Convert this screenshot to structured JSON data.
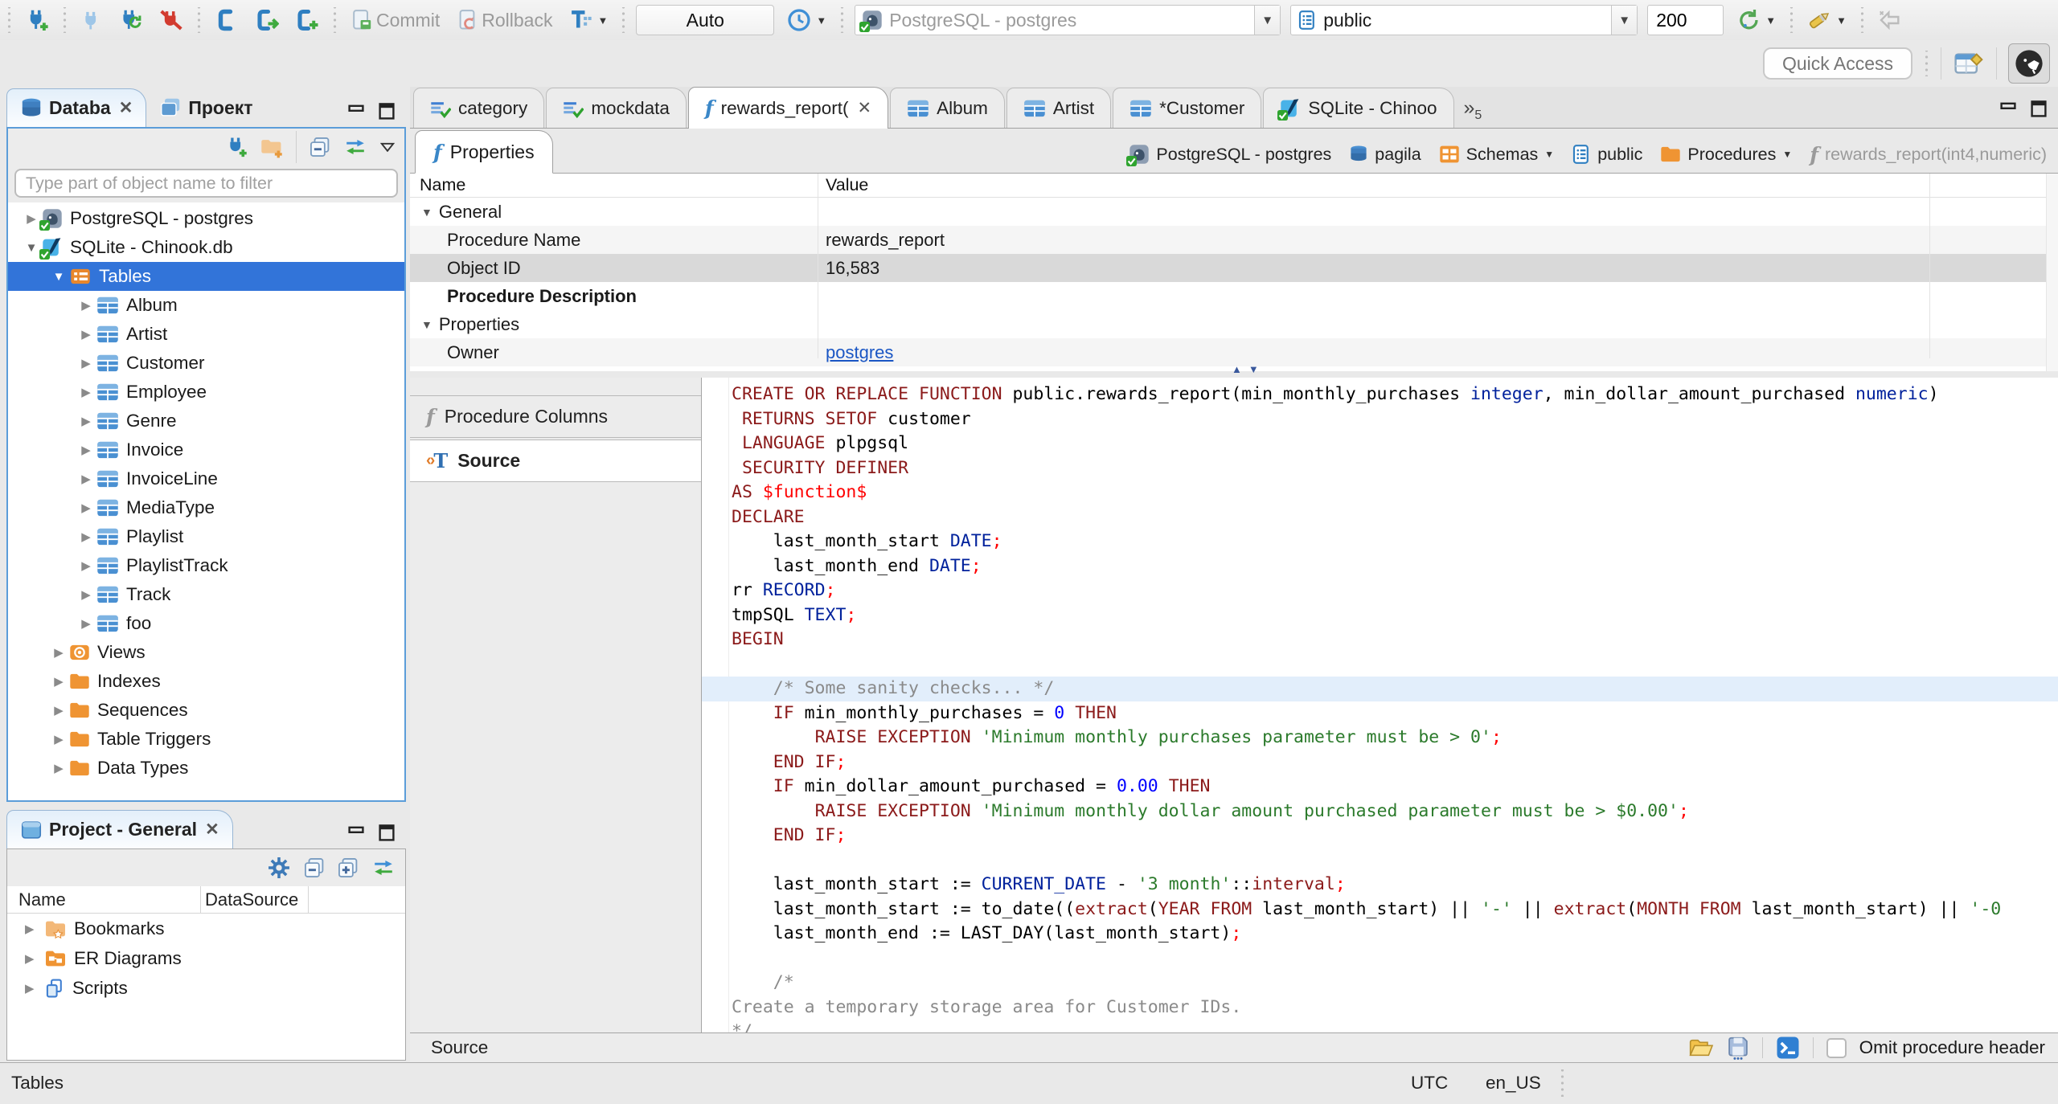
{
  "toolbar": {
    "commit_label": "Commit",
    "rollback_label": "Rollback",
    "auto_label": "Auto",
    "connection_combo_value": "PostgreSQL - postgres",
    "schema_combo_value": "public",
    "fetch_size_value": "200",
    "quick_access_placeholder": "Quick Access"
  },
  "left_panel": {
    "tabs": [
      {
        "label": "Databa",
        "closable": true,
        "active": true
      },
      {
        "label": "Проект",
        "closable": false,
        "active": false
      }
    ],
    "filter_placeholder": "Type part of object name to filter",
    "tree": [
      {
        "label": "PostgreSQL - postgres",
        "type": "postgres",
        "level": 0,
        "state": "collapsed"
      },
      {
        "label": "SQLite - Chinook.db",
        "type": "sqlite",
        "level": 0,
        "state": "expanded"
      },
      {
        "label": "Tables",
        "type": "tables-folder",
        "level": 1,
        "state": "expanded",
        "selected": true
      },
      {
        "label": "Album",
        "type": "table",
        "level": 2,
        "state": "collapsed"
      },
      {
        "label": "Artist",
        "type": "table",
        "level": 2,
        "state": "collapsed"
      },
      {
        "label": "Customer",
        "type": "table",
        "level": 2,
        "state": "collapsed"
      },
      {
        "label": "Employee",
        "type": "table",
        "level": 2,
        "state": "collapsed"
      },
      {
        "label": "Genre",
        "type": "table",
        "level": 2,
        "state": "collapsed"
      },
      {
        "label": "Invoice",
        "type": "table",
        "level": 2,
        "state": "collapsed"
      },
      {
        "label": "InvoiceLine",
        "type": "table",
        "level": 2,
        "state": "collapsed"
      },
      {
        "label": "MediaType",
        "type": "table",
        "level": 2,
        "state": "collapsed"
      },
      {
        "label": "Playlist",
        "type": "table",
        "level": 2,
        "state": "collapsed"
      },
      {
        "label": "PlaylistTrack",
        "type": "table",
        "level": 2,
        "state": "collapsed"
      },
      {
        "label": "Track",
        "type": "table",
        "level": 2,
        "state": "collapsed"
      },
      {
        "label": "foo",
        "type": "table",
        "level": 2,
        "state": "collapsed"
      },
      {
        "label": "Views",
        "type": "views-folder",
        "level": 1,
        "state": "collapsed"
      },
      {
        "label": "Indexes",
        "type": "folder",
        "level": 1,
        "state": "collapsed"
      },
      {
        "label": "Sequences",
        "type": "folder",
        "level": 1,
        "state": "collapsed"
      },
      {
        "label": "Table Triggers",
        "type": "folder",
        "level": 1,
        "state": "collapsed"
      },
      {
        "label": "Data Types",
        "type": "folder",
        "level": 1,
        "state": "collapsed"
      }
    ]
  },
  "project_panel": {
    "title": "Project - General",
    "columns": [
      "Name",
      "DataSource"
    ],
    "items": [
      {
        "label": "Bookmarks",
        "type": "bookmark-folder"
      },
      {
        "label": "ER Diagrams",
        "type": "er-folder"
      },
      {
        "label": "Scripts",
        "type": "scripts"
      }
    ]
  },
  "editor_tabs": [
    {
      "label": "category",
      "icon": "sql-script",
      "active": false,
      "closable": false
    },
    {
      "label": "mockdata",
      "icon": "sql-script",
      "active": false,
      "closable": false
    },
    {
      "label": "rewards_report(",
      "icon": "function",
      "active": true,
      "closable": true
    },
    {
      "label": "Album",
      "icon": "table",
      "active": false,
      "closable": false
    },
    {
      "label": "Artist",
      "icon": "table",
      "active": false,
      "closable": false
    },
    {
      "label": "*Customer",
      "icon": "table",
      "active": false,
      "closable": false
    },
    {
      "label": "SQLite - Chinoo",
      "icon": "sqlite",
      "active": false,
      "closable": false
    }
  ],
  "tab_overflow_count": "5",
  "properties_view": {
    "tab_label": "Properties",
    "breadcrumb": [
      {
        "label": "PostgreSQL - postgres",
        "icon": "postgres",
        "dropdown": false,
        "disabled": false
      },
      {
        "label": "pagila",
        "icon": "database",
        "dropdown": false,
        "disabled": false
      },
      {
        "label": "Schemas",
        "icon": "schemas",
        "dropdown": true,
        "disabled": false
      },
      {
        "label": "public",
        "icon": "schema",
        "dropdown": false,
        "disabled": false
      },
      {
        "label": "Procedures",
        "icon": "folder",
        "dropdown": true,
        "disabled": false
      },
      {
        "label": "rewards_report(int4,numeric)",
        "icon": "function",
        "dropdown": false,
        "disabled": true
      }
    ],
    "grid": {
      "columns": [
        "Name",
        "Value"
      ],
      "rows": [
        {
          "name": "General",
          "value": "",
          "group": true
        },
        {
          "name": "Procedure Name",
          "value": "rewards_report",
          "alt": true
        },
        {
          "name": "Object ID",
          "value": "16,583",
          "selected": true
        },
        {
          "name": "Procedure Description",
          "value": "",
          "bold": true
        },
        {
          "name": "Properties",
          "value": "",
          "group": true
        },
        {
          "name": "Owner",
          "value": "postgres",
          "link": true,
          "alt": true
        }
      ]
    },
    "sub_tabs": [
      {
        "label": "Procedure Columns",
        "active": false
      },
      {
        "label": "Source",
        "active": true
      }
    ]
  },
  "source_editor": {
    "colors": {
      "kw": "#8b1a1a",
      "ty": "#00219c",
      "nm": "#0000ff",
      "st": "#2b7a2b",
      "rd": "#ff0000",
      "cm": "#8a8a8a",
      "pl": "#000000"
    },
    "highlight_color": "#e2eefb",
    "lines": [
      {
        "tokens": [
          [
            "kw",
            "CREATE OR REPLACE FUNCTION"
          ],
          [
            "pl",
            " public.rewards_report(min_monthly_purchases "
          ],
          [
            "ty",
            "integer"
          ],
          [
            "pl",
            ", min_dollar_amount_purchased "
          ],
          [
            "ty",
            "numeric"
          ],
          [
            "pl",
            ")"
          ]
        ]
      },
      {
        "tokens": [
          [
            "pl",
            " "
          ],
          [
            "kw",
            "RETURNS SETOF"
          ],
          [
            "pl",
            " customer"
          ]
        ]
      },
      {
        "tokens": [
          [
            "pl",
            " "
          ],
          [
            "kw",
            "LANGUAGE"
          ],
          [
            "pl",
            " plpgsql"
          ]
        ]
      },
      {
        "tokens": [
          [
            "pl",
            " "
          ],
          [
            "kw",
            "SECURITY DEFINER"
          ]
        ]
      },
      {
        "tokens": [
          [
            "kw",
            "AS"
          ],
          [
            "pl",
            " "
          ],
          [
            "rd",
            "$function$"
          ]
        ]
      },
      {
        "tokens": [
          [
            "kw",
            "DECLARE"
          ]
        ]
      },
      {
        "tokens": [
          [
            "pl",
            "    last_month_start "
          ],
          [
            "ty",
            "DATE"
          ],
          [
            "rd",
            ";"
          ]
        ]
      },
      {
        "tokens": [
          [
            "pl",
            "    last_month_end "
          ],
          [
            "ty",
            "DATE"
          ],
          [
            "rd",
            ";"
          ]
        ]
      },
      {
        "tokens": [
          [
            "pl",
            "rr "
          ],
          [
            "ty",
            "RECORD"
          ],
          [
            "rd",
            ";"
          ]
        ]
      },
      {
        "tokens": [
          [
            "pl",
            "tmpSQL "
          ],
          [
            "ty",
            "TEXT"
          ],
          [
            "rd",
            ";"
          ]
        ]
      },
      {
        "tokens": [
          [
            "kw",
            "BEGIN"
          ]
        ]
      },
      {
        "tokens": []
      },
      {
        "tokens": [
          [
            "cm",
            "    /* Some sanity checks... */"
          ]
        ],
        "highlight": true
      },
      {
        "tokens": [
          [
            "pl",
            "    "
          ],
          [
            "kw",
            "IF"
          ],
          [
            "pl",
            " min_monthly_purchases = "
          ],
          [
            "nm",
            "0"
          ],
          [
            "pl",
            " "
          ],
          [
            "kw",
            "THEN"
          ]
        ]
      },
      {
        "tokens": [
          [
            "pl",
            "        "
          ],
          [
            "kw",
            "RAISE EXCEPTION"
          ],
          [
            "pl",
            " "
          ],
          [
            "st",
            "'Minimum monthly purchases parameter must be > 0'"
          ],
          [
            "rd",
            ";"
          ]
        ]
      },
      {
        "tokens": [
          [
            "pl",
            "    "
          ],
          [
            "kw",
            "END IF"
          ],
          [
            "rd",
            ";"
          ]
        ]
      },
      {
        "tokens": [
          [
            "pl",
            "    "
          ],
          [
            "kw",
            "IF"
          ],
          [
            "pl",
            " min_dollar_amount_purchased = "
          ],
          [
            "nm",
            "0.00"
          ],
          [
            "pl",
            " "
          ],
          [
            "kw",
            "THEN"
          ]
        ]
      },
      {
        "tokens": [
          [
            "pl",
            "        "
          ],
          [
            "kw",
            "RAISE EXCEPTION"
          ],
          [
            "pl",
            " "
          ],
          [
            "st",
            "'Minimum monthly dollar amount purchased parameter must be > $0.00'"
          ],
          [
            "rd",
            ";"
          ]
        ]
      },
      {
        "tokens": [
          [
            "pl",
            "    "
          ],
          [
            "kw",
            "END IF"
          ],
          [
            "rd",
            ";"
          ]
        ]
      },
      {
        "tokens": []
      },
      {
        "tokens": [
          [
            "pl",
            "    last_month_start := "
          ],
          [
            "ty",
            "CURRENT_DATE"
          ],
          [
            "pl",
            " - "
          ],
          [
            "st",
            "'3 month'"
          ],
          [
            "pl",
            "::"
          ],
          [
            "kw",
            "interval"
          ],
          [
            "rd",
            ";"
          ]
        ]
      },
      {
        "tokens": [
          [
            "pl",
            "    last_month_start := to_date(("
          ],
          [
            "kw",
            "extract"
          ],
          [
            "pl",
            "("
          ],
          [
            "kw",
            "YEAR FROM"
          ],
          [
            "pl",
            " last_month_start) || "
          ],
          [
            "st",
            "'-'"
          ],
          [
            "pl",
            " || "
          ],
          [
            "kw",
            "extract"
          ],
          [
            "pl",
            "("
          ],
          [
            "kw",
            "MONTH FROM"
          ],
          [
            "pl",
            " last_month_start) || "
          ],
          [
            "st",
            "'-0"
          ]
        ]
      },
      {
        "tokens": [
          [
            "pl",
            "    last_month_end := LAST_DAY(last_month_start)"
          ],
          [
            "rd",
            ";"
          ]
        ]
      },
      {
        "tokens": []
      },
      {
        "tokens": [
          [
            "cm",
            "    /*"
          ]
        ]
      },
      {
        "tokens": [
          [
            "cm",
            "Create a temporary storage area for Customer IDs."
          ]
        ]
      },
      {
        "tokens": [
          [
            "cm",
            "*/"
          ]
        ]
      }
    ]
  },
  "editor_footer": {
    "label": "Source",
    "omit_checkbox_label": "Omit procedure header",
    "omit_checked": false
  },
  "status_bar": {
    "left": "Tables",
    "timezone": "UTC",
    "locale": "en_US"
  }
}
